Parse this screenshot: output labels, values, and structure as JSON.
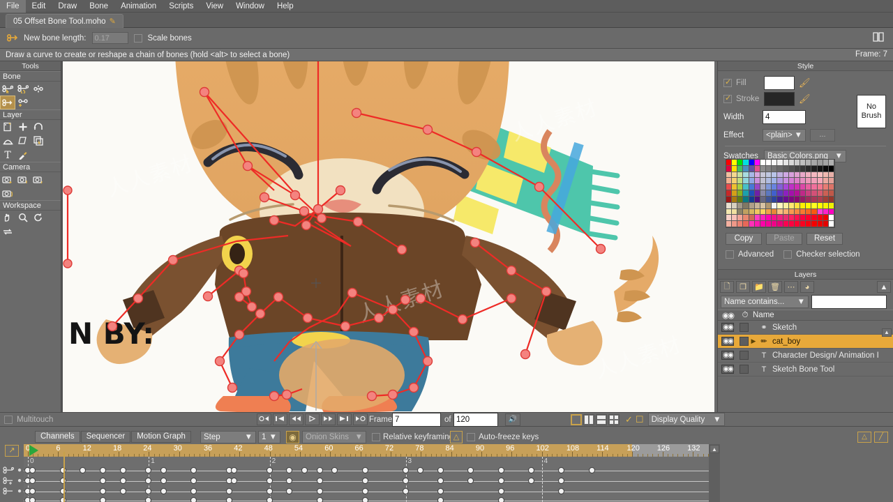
{
  "menu": {
    "items": [
      "File",
      "Edit",
      "Draw",
      "Bone",
      "Animation",
      "Scripts",
      "View",
      "Window",
      "Help"
    ]
  },
  "document": {
    "tab_title": "05 Offset Bone Tool.moho",
    "modified_marker": "✎"
  },
  "options_bar": {
    "tool_icon": "bone-icon",
    "bone_length_label": "New bone length:",
    "bone_length_value": "0.17",
    "scale_bones_label": "Scale bones",
    "scale_bones_checked": false,
    "help_icon": "book-icon"
  },
  "status_bar": {
    "hint": "Draw a curve to create or reshape a chain of bones (hold <alt> to select a bone)",
    "frame_indicator": "Frame: 7"
  },
  "tools": {
    "title": "Tools",
    "sections": [
      {
        "label": "Bone",
        "tools": [
          {
            "name": "select-bone-tool",
            "icon": "bone-select-icon",
            "selected": false
          },
          {
            "name": "rotate-bone-tool",
            "icon": "bone-rotate-icon",
            "selected": false
          },
          {
            "name": "scale-bone-tool",
            "icon": "bone-scale-icon",
            "selected": false
          },
          {
            "name": "offset-bone-tool",
            "icon": "bone-offset-icon",
            "selected": true
          },
          {
            "name": "add-bone-tool",
            "icon": "bone-add-icon",
            "selected": false
          }
        ]
      },
      {
        "label": "Layer",
        "tools": [
          {
            "name": "transform-layer-tool",
            "icon": "layer-transform-icon",
            "selected": false
          },
          {
            "name": "add-layer-tool",
            "icon": "plus-icon",
            "selected": false
          },
          {
            "name": "rotate-layer-xy-tool",
            "icon": "rotate-layer-icon",
            "selected": false
          },
          {
            "name": "shear-layer-tool",
            "icon": "shear-layer-icon",
            "selected": false
          },
          {
            "name": "follow-path-tool",
            "icon": "follow-path-icon",
            "selected": false
          },
          {
            "name": "set-origin-tool",
            "icon": "set-origin-icon",
            "selected": false
          },
          {
            "name": "text-tool",
            "icon": "text-icon",
            "selected": false
          },
          {
            "name": "eyedropper-tool",
            "icon": "eyedropper-icon",
            "selected": false
          }
        ]
      },
      {
        "label": "Camera",
        "tools": [
          {
            "name": "track-camera-tool",
            "icon": "camera-track-icon",
            "selected": false
          },
          {
            "name": "zoom-camera-tool",
            "icon": "camera-zoom-icon",
            "selected": false
          },
          {
            "name": "roll-camera-tool",
            "icon": "camera-roll-icon",
            "selected": false
          },
          {
            "name": "pan-tilt-camera-tool",
            "icon": "camera-pan-icon",
            "selected": false
          }
        ]
      },
      {
        "label": "Workspace",
        "tools": [
          {
            "name": "pan-workspace-tool",
            "icon": "hand-icon",
            "selected": false
          },
          {
            "name": "zoom-workspace-tool",
            "icon": "magnifier-icon",
            "selected": false
          },
          {
            "name": "rotate-workspace-tool",
            "icon": "rotate-icon",
            "selected": false
          },
          {
            "name": "reset-workspace-tool",
            "icon": "reset-icon",
            "selected": false
          }
        ]
      }
    ]
  },
  "canvas": {
    "background": "#fbfaf6",
    "bone_color": "#ee2b26",
    "bone_handle_color": "#f4837f",
    "artwork_text": "N BY:",
    "watermarks": [
      "人人素材",
      "人人素材",
      "人人素材"
    ]
  },
  "style_panel": {
    "title": "Style",
    "fill_label": "Fill",
    "fill_checked": true,
    "fill_color": "#ffffff",
    "stroke_label": "Stroke",
    "stroke_checked": true,
    "stroke_color": "#262626",
    "no_brush_line1": "No",
    "no_brush_line2": "Brush",
    "width_label": "Width",
    "width_value": "4",
    "effect_label": "Effect",
    "effect_value": "<plain>",
    "effect_more": "...",
    "swatches_label": "Swatches",
    "swatches_file": "Basic Colors.png",
    "copy_label": "Copy",
    "paste_label": "Paste",
    "reset_label": "Reset",
    "advanced_label": "Advanced",
    "advanced_checked": false,
    "checker_label": "Checker selection",
    "checker_checked": false
  },
  "layers_panel": {
    "title": "Layers",
    "buttons": [
      {
        "name": "new-layer-button",
        "icon": "new-layer-icon"
      },
      {
        "name": "duplicate-layer-button",
        "icon": "duplicate-layer-icon"
      },
      {
        "name": "new-group-button",
        "icon": "new-group-icon"
      },
      {
        "name": "delete-layer-button",
        "icon": "trash-icon"
      },
      {
        "name": "layer-options-button",
        "icon": "ellipsis-icon"
      },
      {
        "name": "layer-comp-button",
        "icon": "layer-comp-icon"
      }
    ],
    "collapse_icon": "chevron-up-icon",
    "filter_mode": "Name contains...",
    "filter_value": "",
    "col_visibility": "visibility-icon",
    "col_lock": "lock-icon",
    "col_name": "Name",
    "rows": [
      {
        "name": "Sketch",
        "type_icon": "bone-layer-icon",
        "visible": true,
        "locked": false,
        "selected": false,
        "expandable": false
      },
      {
        "name": "cat_boy",
        "type_icon": "bone-group-icon",
        "visible": true,
        "locked": false,
        "selected": true,
        "expandable": true
      },
      {
        "name": "Character Design/ Animation I",
        "type_icon": "text-layer-icon",
        "visible": true,
        "locked": false,
        "selected": false,
        "expandable": false
      },
      {
        "name": "Sketch Bone Tool",
        "type_icon": "text-layer-icon",
        "visible": true,
        "locked": false,
        "selected": false,
        "expandable": false
      }
    ]
  },
  "playback_bar": {
    "multitouch_label": "Multitouch",
    "multitouch_checked": false,
    "buttons": [
      {
        "name": "jump-to-start-button",
        "icon": "rewind-end-icon"
      },
      {
        "name": "previous-keyframe-button",
        "icon": "prev-key-icon"
      },
      {
        "name": "step-back-button",
        "icon": "step-back-icon"
      },
      {
        "name": "play-button",
        "icon": "play-icon"
      },
      {
        "name": "step-forward-button",
        "icon": "step-forward-icon"
      },
      {
        "name": "next-keyframe-button",
        "icon": "next-key-icon"
      },
      {
        "name": "jump-to-end-button",
        "icon": "forward-end-icon"
      }
    ],
    "frame_label": "Frame",
    "frame_value": "7",
    "of_label": "of",
    "total_frames": "120",
    "audio_icon": "speaker-icon",
    "view_buttons": [
      {
        "name": "single-view-button",
        "icon": "single-pane-icon",
        "active": true
      },
      {
        "name": "two-column-view-button",
        "icon": "two-column-icon",
        "active": false
      },
      {
        "name": "two-row-view-button",
        "icon": "two-row-icon",
        "active": false
      },
      {
        "name": "quad-view-button",
        "icon": "quad-pane-icon",
        "active": false
      }
    ],
    "toggle_check": true,
    "crop_icon": "crop-icon",
    "display_quality_label": "Display Quality"
  },
  "timeline_toolbar": {
    "tabs": [
      {
        "name": "channels-tab",
        "label": "Channels",
        "active": true
      },
      {
        "name": "sequencer-tab",
        "label": "Sequencer",
        "active": false
      },
      {
        "name": "motion-graph-tab",
        "label": "Motion Graph",
        "active": false
      }
    ],
    "interp_value": "Step",
    "step_count": "1",
    "onion_toggle_icon": "onion-icon",
    "onion_label": "Onion Skins",
    "relative_keyframing_label": "Relative keyframing",
    "relative_keyframing_checked": false,
    "freeze_icon": "shield-icon",
    "auto_freeze_label": "Auto-freeze keys",
    "auto_freeze_checked": false,
    "ease_in_icon": "ease-in-icon",
    "ease_out_icon": "ease-out-icon"
  },
  "timeline": {
    "expand_icon": "expand-icon",
    "current_frame": 7,
    "ruler_ticks": [
      0,
      6,
      12,
      18,
      24,
      30,
      36,
      42,
      48,
      54,
      60,
      66,
      72,
      78,
      84,
      90,
      96,
      102,
      108,
      114,
      120,
      126,
      132
    ],
    "ruler_max": 136,
    "ruler_active_end": 120,
    "playhead_frame": 7,
    "segment_markers": [
      {
        "label": "0",
        "frame": 0
      },
      {
        "label": "1",
        "frame": 24
      },
      {
        "label": "2",
        "frame": 48
      },
      {
        "label": "3",
        "frame": 75
      },
      {
        "label": "4",
        "frame": 102
      }
    ],
    "channel_icons": [
      "bone-rotate-channel-icon",
      "bone-translate-channel-icon",
      "bone-scale-channel-icon"
    ],
    "keyframe_rows": [
      [
        0,
        1,
        7,
        11,
        15,
        19,
        24,
        27,
        33,
        40,
        41,
        48,
        52,
        55,
        58,
        61,
        67,
        75,
        78,
        82,
        88,
        94,
        100,
        106,
        112
      ],
      [
        0,
        1,
        7,
        15,
        19,
        24,
        27,
        33,
        40,
        41,
        48,
        52,
        58,
        67,
        75,
        82,
        88,
        94,
        100,
        106
      ],
      [
        0,
        1,
        7,
        15,
        19,
        24,
        27,
        33,
        40,
        48,
        52,
        58,
        67,
        75,
        82,
        94,
        106
      ],
      [
        0,
        1,
        7,
        15,
        24,
        33,
        40,
        48,
        58,
        67,
        82,
        94
      ]
    ],
    "scroll_up_icon": "scroll-up-icon"
  }
}
